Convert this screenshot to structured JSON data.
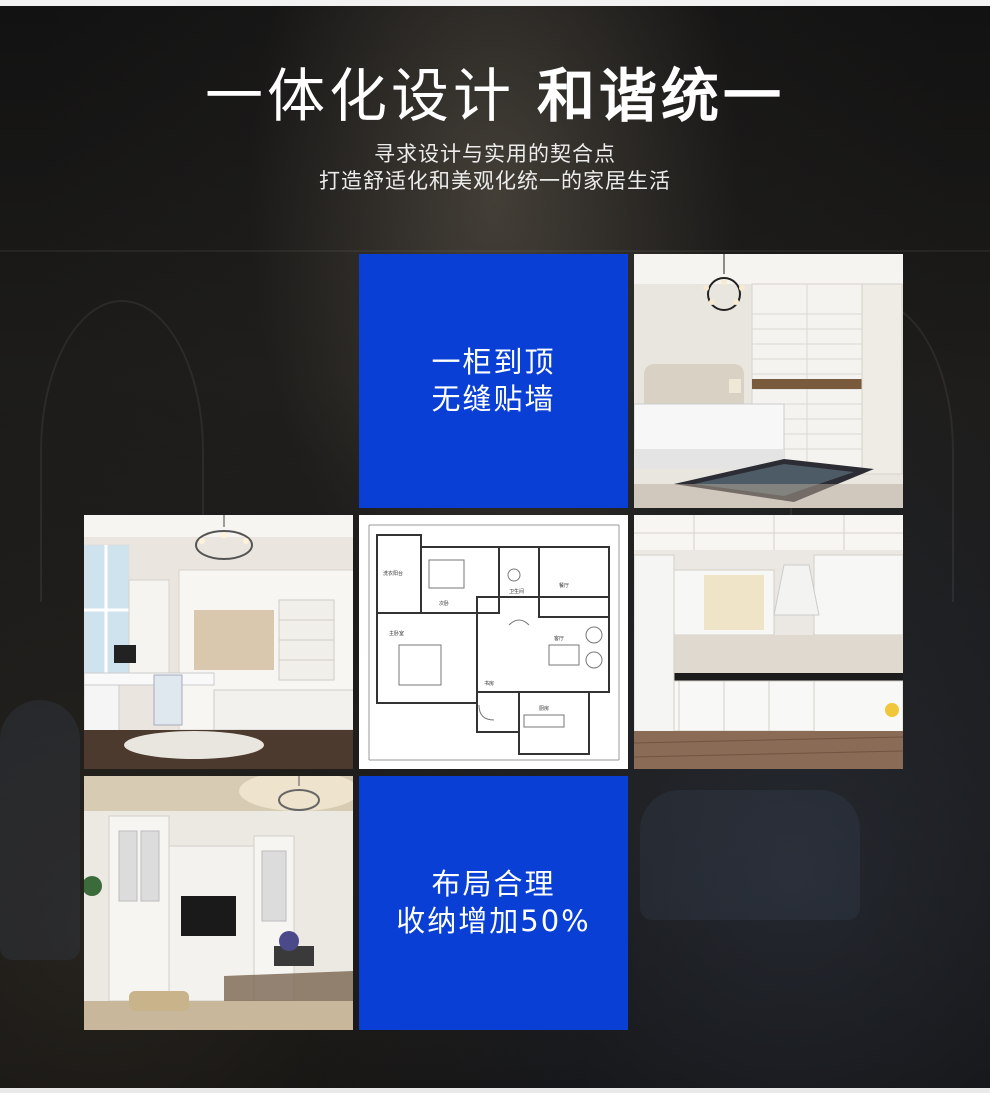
{
  "header": {
    "title_part1": "一体化设计",
    "title_part2": "和谐统一",
    "subtitle_line1": "寻求设计与实用的契合点",
    "subtitle_line2": "打造舒适化和美观化统一的家居生活"
  },
  "tiles": {
    "feature1": {
      "line1": "一柜到顶",
      "line2": "无缝贴墙"
    },
    "feature2": {
      "line1": "布局合理",
      "line2": "收纳增加50%"
    }
  },
  "floorplan_labels": {
    "l1": "洗衣阳台",
    "l2": "次卧",
    "l3": "卫生间",
    "l4": "餐厅",
    "l5": "主卧室",
    "l6": "客厅",
    "l7": "厨房",
    "l8": "书房"
  },
  "colors": {
    "accent_blue": "#0a3fd6",
    "background": "#111111"
  }
}
